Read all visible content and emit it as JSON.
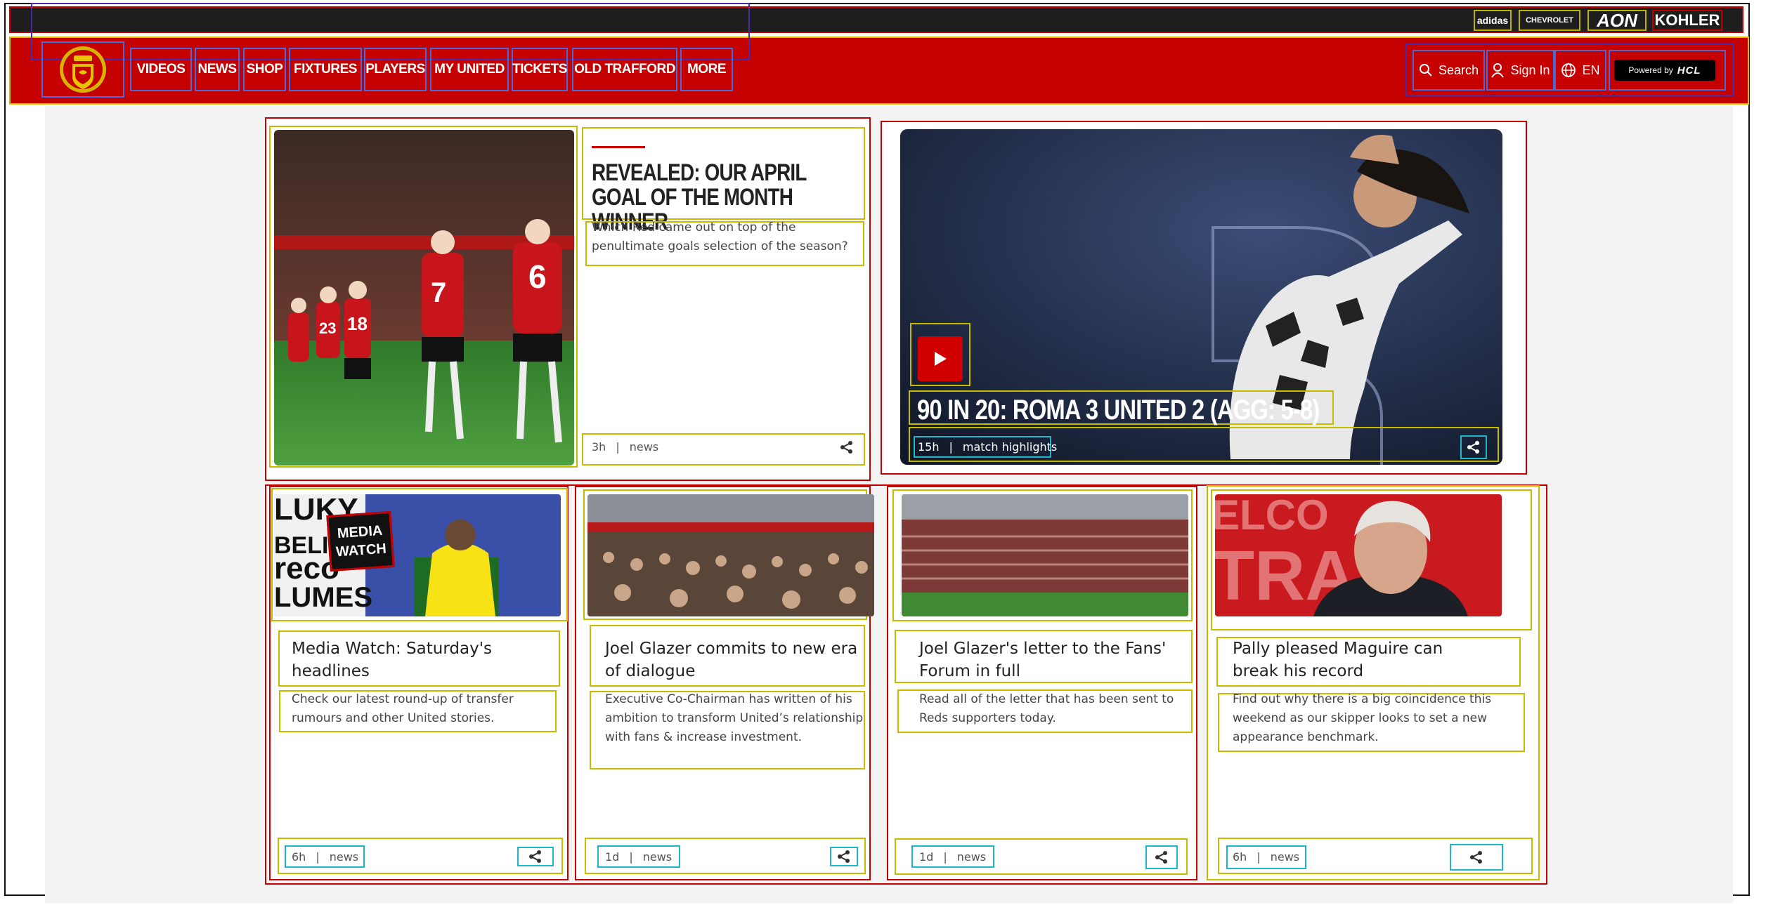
{
  "sponsors": {
    "adidas": "adidas",
    "chevrolet": "CHEVROLET",
    "aon": "AON",
    "kohler": "KOHLER"
  },
  "nav": {
    "items": [
      "VIDEOS",
      "NEWS",
      "SHOP",
      "FIXTURES",
      "PLAYERS",
      "MY UNITED",
      "TICKETS",
      "OLD TRAFFORD",
      "MORE"
    ],
    "search": "Search",
    "sign_in": "Sign In",
    "language": "EN",
    "powered_by": "Powered by",
    "powered_brand": "HCL"
  },
  "hero": {
    "headline": "REVEALED: OUR APRIL GOAL OF THE MONTH WINNER",
    "description": "Which Red came out on top of the penultimate goals selection of the season?",
    "age": "3h",
    "category": "news"
  },
  "video": {
    "headline": "90 IN 20: ROMA 3 UNITED 2 (AGG: 5-8)",
    "age": "15h",
    "category": "match highlights"
  },
  "cards": [
    {
      "title": "Media Watch: Saturday's headlines",
      "description": "Check our latest round-up of transfer rumours and other United stories.",
      "age": "6h",
      "category": "news",
      "badge_line1": "MEDIA",
      "badge_line2": "WATCH"
    },
    {
      "title": "Joel Glazer commits to new era of dialogue",
      "description": "Executive Co-Chairman has written of his ambition to transform United’s relationship with fans & increase investment.",
      "age": "1d",
      "category": "news"
    },
    {
      "title": "Joel Glazer's letter to the Fans' Forum in full",
      "description": "Read all of the letter that has been sent to Reds supporters today.",
      "age": "1d",
      "category": "news"
    },
    {
      "title": "Pally pleased Maguire can break his record",
      "description": "Find out why there is a big coincidence this weekend as our skipper looks to set a new appearance benchmark.",
      "age": "6h",
      "category": "news"
    }
  ],
  "separator": "|",
  "colors": {
    "brand_red": "#c40000",
    "dark": "#1e1e1e",
    "accent_yellow": "#c7bb00",
    "accent_teal": "#1db7c9"
  }
}
